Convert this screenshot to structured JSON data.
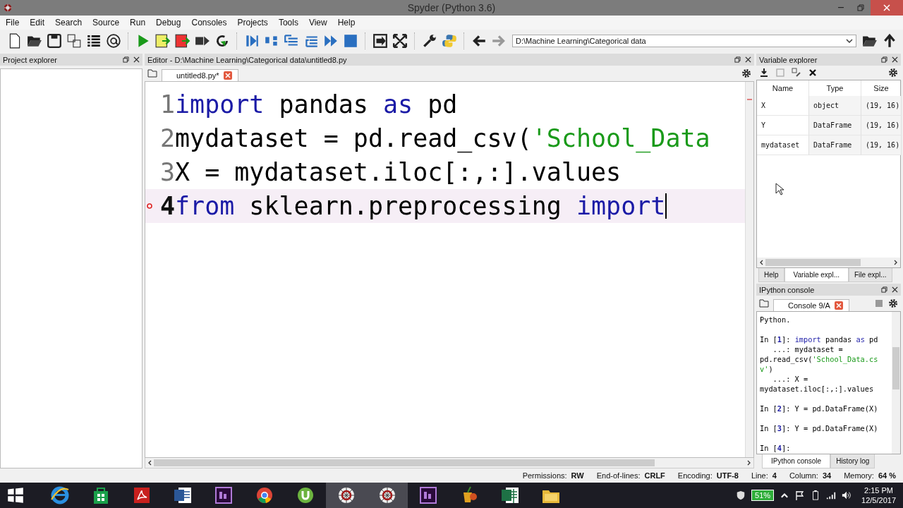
{
  "window": {
    "title": "Spyder (Python 3.6)"
  },
  "menu": [
    "File",
    "Edit",
    "Search",
    "Source",
    "Run",
    "Debug",
    "Consoles",
    "Projects",
    "Tools",
    "View",
    "Help"
  ],
  "toolbar": {
    "path": "D:\\Machine Learning\\Categorical data"
  },
  "project_explorer": {
    "title": "Project explorer"
  },
  "editor": {
    "title": "Editor - D:\\Machine Learning\\Categorical data\\untitled8.py",
    "tabs": [
      {
        "label": "untitled8.py*",
        "selected": true
      }
    ],
    "lines": [
      {
        "number": "1",
        "current": false,
        "warning": false,
        "tokens": [
          {
            "kind": "keyword",
            "text": "import"
          },
          {
            "kind": "plain",
            "text": " pandas "
          },
          {
            "kind": "keyword",
            "text": "as"
          },
          {
            "kind": "plain",
            "text": " pd"
          }
        ]
      },
      {
        "number": "2",
        "current": false,
        "warning": false,
        "tokens": [
          {
            "kind": "plain",
            "text": "mydataset = pd.read_csv("
          },
          {
            "kind": "string",
            "text": "'School_Data"
          }
        ]
      },
      {
        "number": "3",
        "current": false,
        "warning": false,
        "tokens": [
          {
            "kind": "plain",
            "text": "X = mydataset.iloc[:,:].values"
          }
        ]
      },
      {
        "number": "4",
        "current": true,
        "warning": true,
        "tokens": [
          {
            "kind": "keyword",
            "text": "from"
          },
          {
            "kind": "plain",
            "text": " sklearn.preprocessing "
          },
          {
            "kind": "keyword",
            "text": "import"
          }
        ]
      }
    ]
  },
  "variable_explorer": {
    "title": "Variable explorer",
    "columns": [
      "Name",
      "Type",
      "Size"
    ],
    "rows": [
      [
        "X",
        "object",
        "(19, 16)"
      ],
      [
        "Y",
        "DataFrame",
        "(19, 16)"
      ],
      [
        "mydataset",
        "DataFrame",
        "(19, 16)"
      ]
    ],
    "tabs": [
      {
        "label": "Help",
        "selected": false
      },
      {
        "label": "Variable expl...",
        "selected": true
      },
      {
        "label": "File expl...",
        "selected": false
      }
    ]
  },
  "console": {
    "title": "IPython console",
    "tabs": [
      {
        "label": "Console 9/A",
        "selected": true
      }
    ],
    "blocks": [
      {
        "lines": [
          {
            "tokens": [
              {
                "kind": "plain",
                "text": "Python."
              }
            ]
          }
        ]
      },
      {
        "lines": [
          {
            "tokens": [
              {
                "kind": "plain",
                "text": "In ["
              },
              {
                "kind": "number",
                "text": "1"
              },
              {
                "kind": "plain",
                "text": "]: "
              },
              {
                "kind": "keyword",
                "text": "import"
              },
              {
                "kind": "plain",
                "text": " pandas "
              },
              {
                "kind": "keyword",
                "text": "as"
              },
              {
                "kind": "plain",
                "text": " pd"
              }
            ]
          },
          {
            "tokens": [
              {
                "kind": "plain",
                "text": "   ...: mydataset ="
              }
            ]
          },
          {
            "tokens": [
              {
                "kind": "plain",
                "text": "pd.read_csv("
              },
              {
                "kind": "string",
                "text": "'School_Data.cs"
              }
            ]
          },
          {
            "tokens": [
              {
                "kind": "string",
                "text": "v'"
              },
              {
                "kind": "plain",
                "text": ")"
              }
            ]
          },
          {
            "tokens": [
              {
                "kind": "plain",
                "text": "   ...: X ="
              }
            ]
          },
          {
            "tokens": [
              {
                "kind": "plain",
                "text": "mydataset.iloc[:,:].values"
              }
            ]
          }
        ]
      },
      {
        "lines": [
          {
            "tokens": [
              {
                "kind": "plain",
                "text": "In ["
              },
              {
                "kind": "number",
                "text": "2"
              },
              {
                "kind": "plain",
                "text": "]: Y = pd.DataFrame(X)"
              }
            ]
          }
        ]
      },
      {
        "lines": [
          {
            "tokens": [
              {
                "kind": "plain",
                "text": "In ["
              },
              {
                "kind": "number",
                "text": "3"
              },
              {
                "kind": "plain",
                "text": "]: Y = pd.DataFrame(X)"
              }
            ]
          }
        ]
      },
      {
        "lines": [
          {
            "tokens": [
              {
                "kind": "plain",
                "text": "In ["
              },
              {
                "kind": "number",
                "text": "4"
              },
              {
                "kind": "plain",
                "text": "]:"
              }
            ]
          }
        ]
      }
    ],
    "bottom_tabs": [
      {
        "label": "IPython console",
        "selected": true
      },
      {
        "label": "History log",
        "selected": false
      }
    ]
  },
  "status_bar": [
    {
      "label": "Permissions:",
      "value": "RW"
    },
    {
      "label": "End-of-lines:",
      "value": "CRLF"
    },
    {
      "label": "Encoding:",
      "value": "UTF-8"
    },
    {
      "label": "Line:",
      "value": "4"
    },
    {
      "label": "Column:",
      "value": "34"
    },
    {
      "label": "Memory:",
      "value": "64 %"
    }
  ],
  "taskbar": {
    "apps": [
      {
        "kind": "browser",
        "selected": false
      },
      {
        "kind": "store",
        "selected": false
      },
      {
        "kind": "pdf",
        "selected": false
      },
      {
        "kind": "document",
        "selected": false
      },
      {
        "kind": "video",
        "selected": false
      },
      {
        "kind": "globe",
        "selected": false
      },
      {
        "kind": "torrent",
        "selected": false
      },
      {
        "kind": "web",
        "selected": true
      },
      {
        "kind": "web",
        "selected": true
      },
      {
        "kind": "video",
        "selected": false
      },
      {
        "kind": "drink",
        "selected": false
      },
      {
        "kind": "sheet",
        "selected": false
      },
      {
        "kind": "folder",
        "selected": false
      }
    ],
    "battery": "51%",
    "time": "2:15 PM",
    "date": "12/5/2017"
  }
}
